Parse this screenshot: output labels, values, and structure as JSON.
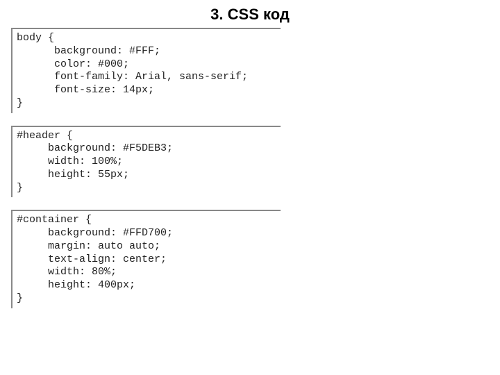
{
  "title": "3. CSS код",
  "blocks": {
    "body": "body {\n      background: #FFF;\n      color: #000;\n      font-family: Arial, sans-serif;\n      font-size: 14px;\n}",
    "header": "#header {\n     background: #F5DEB3;\n     width: 100%;\n     height: 55px;\n}",
    "container": "#container {\n     background: #FFD700;\n     margin: auto auto;\n     text-align: center;\n     width: 80%;\n     height: 400px;\n}"
  }
}
